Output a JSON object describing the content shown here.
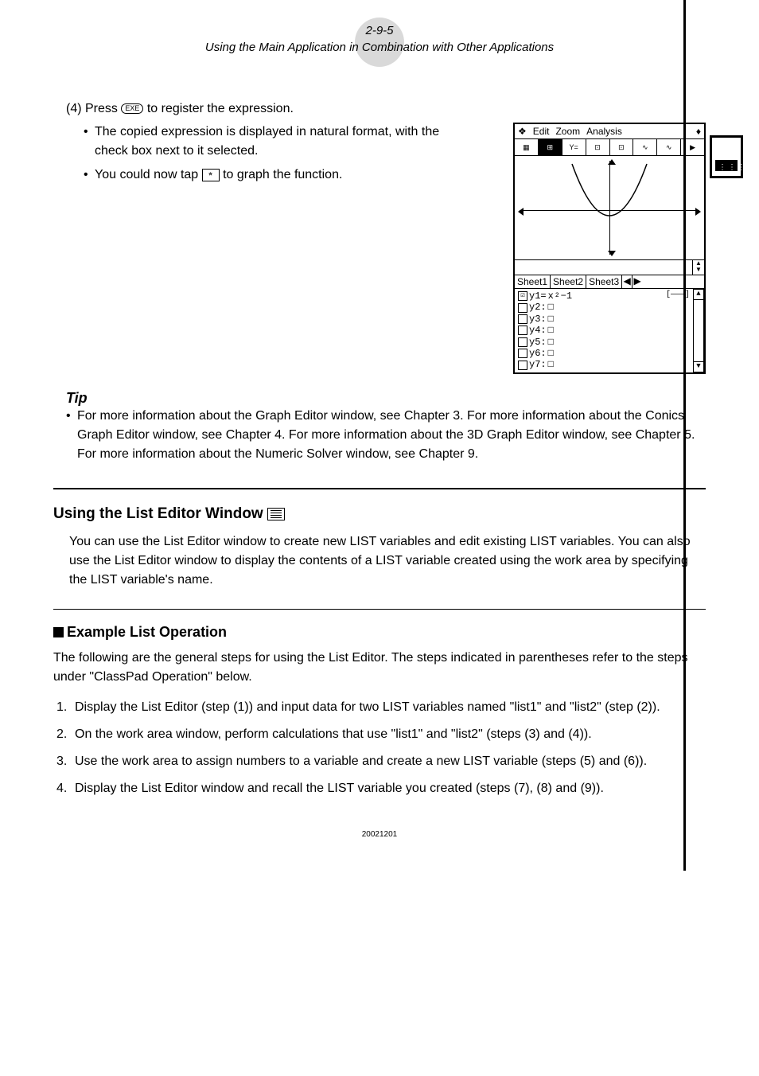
{
  "header": {
    "page_number": "2-9-5",
    "subtitle": "Using the Main Application in Combination with Other Applications"
  },
  "step4": {
    "line": "(4) Press",
    "exe": "EXE",
    "after": "to register the expression.",
    "bullet1": "The copied expression is displayed in natural format, with the check box next to it selected.",
    "bullet2_a": "You could now tap",
    "bullet2_b": "to graph the function."
  },
  "calc_screen": {
    "menu": {
      "edit": "Edit",
      "zoom": "Zoom",
      "analysis": "Analysis"
    },
    "tabs": {
      "s1": "Sheet1",
      "s2": "Sheet2",
      "s3": "Sheet3"
    },
    "eq": {
      "y1": "y1=",
      "y1_expr_base": "x",
      "y1_expr_exp": "2",
      "y1_expr_tail": "−1",
      "y2": "y2:",
      "y3": "y3:",
      "y4": "y4:",
      "y5": "y5:",
      "y6": "y6:",
      "y7": "y7:",
      "sq": "□"
    }
  },
  "tip": {
    "heading": "Tip",
    "body": "For more information about the Graph Editor window, see Chapter 3. For more information about the Conics Graph Editor window, see Chapter 4. For more information about the 3D Graph Editor window, see Chapter 5. For more information about the Numeric Solver window, see Chapter 9."
  },
  "list_section": {
    "heading": "Using the List Editor Window",
    "body": "You can use the List Editor window to create new LIST variables and edit existing LIST variables. You can also use the List Editor window to display the contents of a LIST variable created using the work area by specifying the LIST variable's name."
  },
  "example": {
    "heading": "Example List Operation",
    "intro": "The following are the general steps for using the List Editor. The steps indicated in parentheses refer to the steps under \"ClassPad Operation\" below.",
    "items": [
      "Display the List Editor (step (1)) and input data for two LIST variables named \"list1\" and \"list2\" (step (2)).",
      "On the work area window, perform calculations that use \"list1\" and \"list2\" (steps (3) and (4)).",
      "Use the work area to assign numbers to a variable and create a new LIST variable (steps (5) and (6)).",
      "Display the List Editor window and recall the LIST variable you created  (steps (7), (8) and (9))."
    ]
  },
  "footer": {
    "code": "20021201"
  }
}
